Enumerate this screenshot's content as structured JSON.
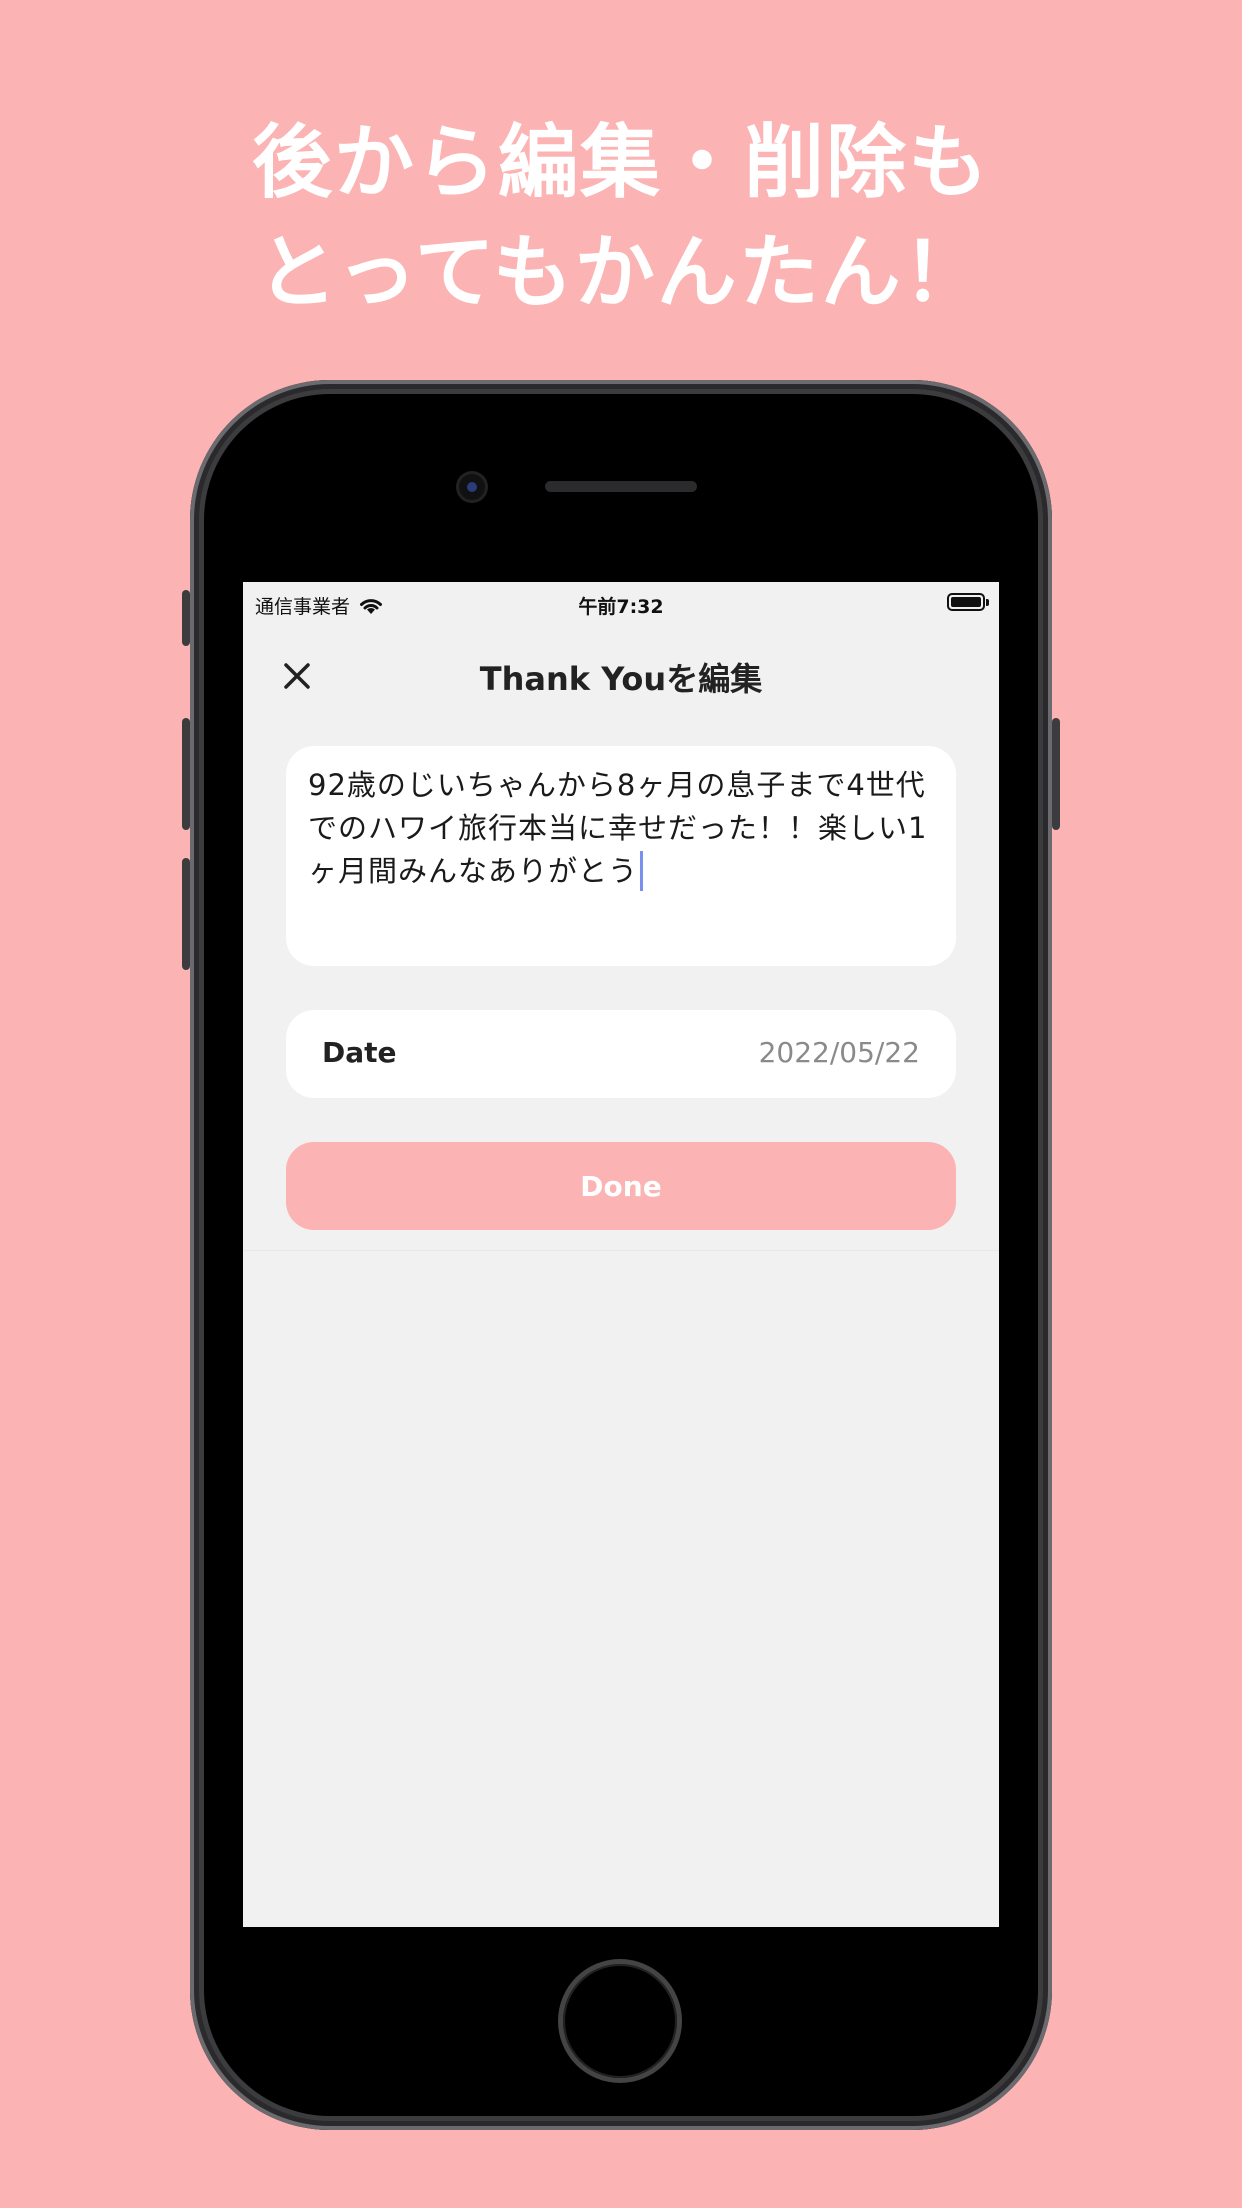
{
  "headline": {
    "line1": "後から編集・削除も",
    "line2": "とってもかんたん！"
  },
  "statusbar": {
    "carrier": "通信事業者",
    "time": "午前7:32"
  },
  "navbar": {
    "title": "Thank Youを編集"
  },
  "editor": {
    "text": "92歳のじいちゃんから8ヶ月の息子まで4世代でのハワイ旅行本当に幸せだった！！楽しい1ヶ月間みんなありがとう"
  },
  "date_row": {
    "label": "Date",
    "value": "2022/05/22"
  },
  "done_button": {
    "label": "Done"
  },
  "colors": {
    "background": "#fbb3b3",
    "accent": "#fbb3b3",
    "screen": "#f0f1f0",
    "caret": "#7b8ff0"
  },
  "icons": [
    "wifi-icon",
    "battery-icon",
    "close-icon"
  ]
}
